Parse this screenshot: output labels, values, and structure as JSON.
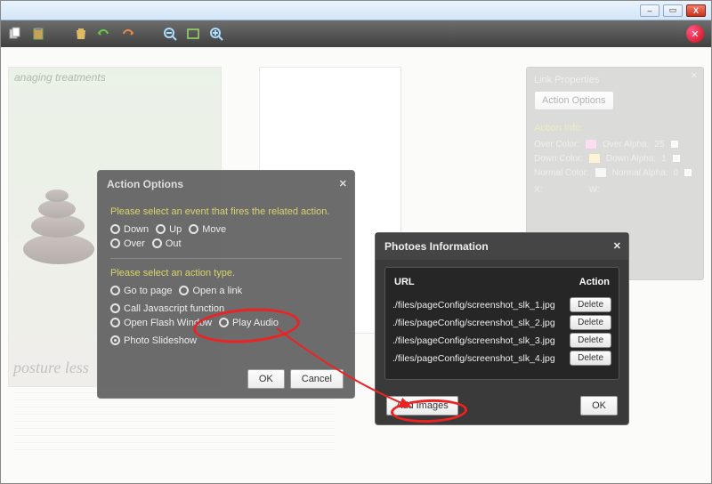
{
  "window": {
    "min": "–",
    "max": "▭",
    "close": "X"
  },
  "rpanel": {
    "title": "Link Properties",
    "actionBtn": "Action Options",
    "section": "Action Info:",
    "over": "Over Color:",
    "overA": "Over Alpha:",
    "overAval": "25",
    "down": "Down Color:",
    "downA": "Down Alpha:",
    "downAval": "1",
    "normal": "Normal Color:",
    "normalA": "Normal Alpha:",
    "normalAval": "0",
    "xl": "X:",
    "wl": "W:"
  },
  "ao": {
    "title": "Action Options",
    "p1": "Please select an event that fires the related action.",
    "down": "Down",
    "up": "Up",
    "move": "Move",
    "over": "Over",
    "out": "Out",
    "p2": "Please select an action type.",
    "goto": "Go to page",
    "link": "Open a link",
    "js": "Call Javascript function",
    "flash": "Open Flash Window",
    "audio": "Play Audio",
    "slide": "Photo Slideshow",
    "ok": "OK",
    "cancel": "Cancel"
  },
  "pi": {
    "title": "Photoes Information",
    "url": "URL",
    "action": "Action",
    "rows": [
      "./files/pageConfig/screenshot_slk_1.jpg",
      "./files/pageConfig/screenshot_slk_2.jpg",
      "./files/pageConfig/screenshot_slk_3.jpg",
      "./files/pageConfig/screenshot_slk_4.jpg"
    ],
    "del": "Delete",
    "add": "Add Images",
    "ok": "OK"
  },
  "page": {
    "caption": "posture less",
    "heading": "anaging treatments"
  }
}
